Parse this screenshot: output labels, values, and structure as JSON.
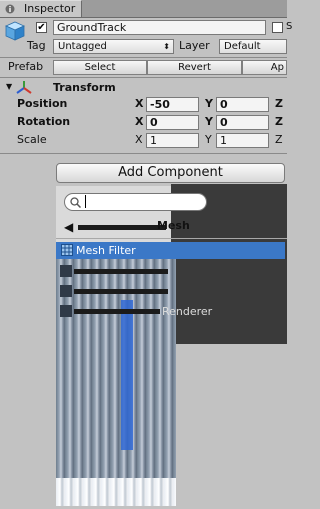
{
  "tabs": {
    "inspector": "Inspector"
  },
  "gameobject": {
    "name": "GroundTrack",
    "active": true,
    "static_initial": "S",
    "tag_label": "Tag",
    "tag_value": "Untagged",
    "layer_label": "Layer",
    "layer_value": "Default",
    "prefab_label": "Prefab",
    "prefab_select": "Select",
    "prefab_revert": "Revert",
    "prefab_apply": "Ap"
  },
  "transform": {
    "title": "Transform",
    "position": {
      "label": "Position",
      "x": "-50",
      "y": "0",
      "z": "Z"
    },
    "rotation": {
      "label": "Rotation",
      "x": "0",
      "y": "0",
      "z": "Z"
    },
    "scale": {
      "label": "Scale",
      "x": "1",
      "y": "1",
      "z": "Z"
    },
    "x_label": "X",
    "y_label": "Y"
  },
  "add_component": {
    "button": "Add Component",
    "search_value": "",
    "header": "Mesh",
    "items": [
      {
        "label": "Mesh Filter",
        "selected": true
      },
      {
        "label": "",
        "selected": false
      },
      {
        "label": "",
        "selected": false
      },
      {
        "label": "Renderer",
        "selected": false
      }
    ]
  },
  "colors": {
    "selection": "#3b78c7",
    "panel": "#c2c2c2",
    "overlay": "#3a3a3a"
  }
}
